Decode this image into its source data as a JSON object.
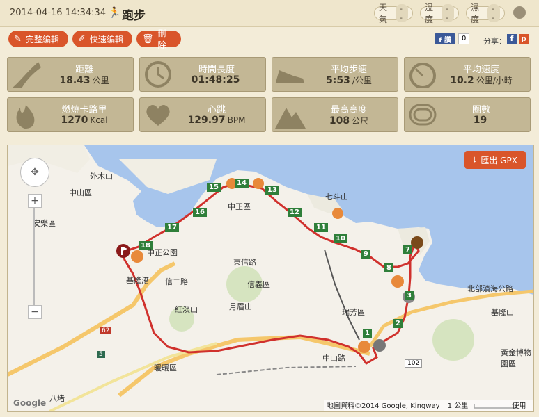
{
  "header": {
    "datetime": "2014-04-16 14:34:34",
    "title": "跑步",
    "weather_label": "天氣",
    "weather_value": "--",
    "temperature_label": "溫度",
    "temperature_value": "--",
    "humidity_label": "濕度",
    "humidity_value": "--"
  },
  "actions": {
    "full_edit": "完整編輯",
    "quick_edit": "快速編輯",
    "delete": "刪除",
    "fb_label": "f 讚",
    "fb_count": "0",
    "share_label": "分享："
  },
  "stats": [
    {
      "label": "距離",
      "value": "18.43",
      "unit": "公里",
      "icon": "road-icon"
    },
    {
      "label": "時間長度",
      "value": "01:48:25",
      "unit": "",
      "icon": "clock-icon"
    },
    {
      "label": "平均步速",
      "value": "5:53",
      "unit": "/公里",
      "icon": "shoe-icon"
    },
    {
      "label": "平均速度",
      "value": "10.2",
      "unit": "公里/小時",
      "icon": "speedometer-icon"
    },
    {
      "label": "燃燒卡路里",
      "value": "1270",
      "unit": "Kcal",
      "icon": "flame-icon"
    },
    {
      "label": "心跳",
      "value": "129.97",
      "unit": "BPM",
      "icon": "heart-icon"
    },
    {
      "label": "最高高度",
      "value": "108",
      "unit": "公尺",
      "icon": "mountain-icon"
    },
    {
      "label": "圈數",
      "value": "19",
      "unit": "",
      "icon": "track-icon"
    }
  ],
  "map": {
    "export_label": "匯出 GPX",
    "attribution": "地圖資料©2014 Google, Kingway",
    "scale_label": "1 公里",
    "terms": "使用條款",
    "google_logo": "Google",
    "place_labels": [
      "外木山",
      "中山區",
      "中正區",
      "七斗山",
      "中正公園",
      "基隆港",
      "信二路",
      "信義區",
      "東信路",
      "月眉山",
      "瑞芳區",
      "北部濱海公路",
      "基隆山",
      "中山路",
      "安樂區",
      "暖暖區",
      "紅淡山",
      "八堵",
      "黃金博物園區"
    ],
    "km_markers": [
      "1",
      "2",
      "3",
      "7",
      "8",
      "9",
      "10",
      "11",
      "12",
      "13",
      "14",
      "15",
      "16",
      "17",
      "18"
    ],
    "road_numbers": [
      "102",
      "62",
      "5"
    ]
  },
  "colors": {
    "accent": "#d9552a",
    "card_bg": "#c3b795",
    "route": "#d0312d",
    "marker_green": "#2f7f3a",
    "water": "#a7c5ec"
  }
}
